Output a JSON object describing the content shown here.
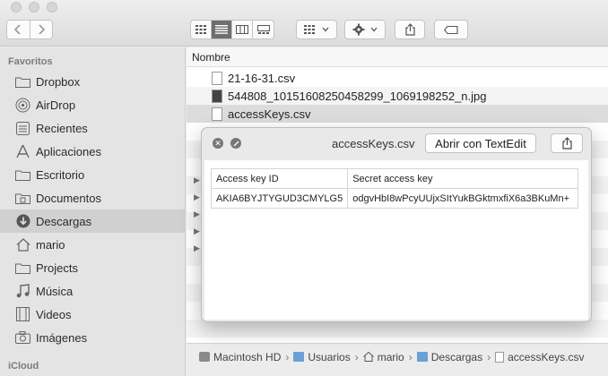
{
  "toolbar": {
    "icons": [
      "back-icon",
      "forward-icon",
      "icon-view-icon",
      "list-view-icon",
      "column-view-icon",
      "gallery-view-icon",
      "arrange-icon",
      "gear-icon",
      "share-icon",
      "tag-icon"
    ]
  },
  "sidebar": {
    "section_favorites": "Favoritos",
    "section_icloud": "iCloud",
    "items": [
      {
        "label": "Dropbox",
        "icon": "folder-icon"
      },
      {
        "label": "AirDrop",
        "icon": "airdrop-icon"
      },
      {
        "label": "Recientes",
        "icon": "recents-icon"
      },
      {
        "label": "Aplicaciones",
        "icon": "applications-icon"
      },
      {
        "label": "Escritorio",
        "icon": "desktop-icon"
      },
      {
        "label": "Documentos",
        "icon": "documents-icon"
      },
      {
        "label": "Descargas",
        "icon": "downloads-icon"
      },
      {
        "label": "mario",
        "icon": "home-icon"
      },
      {
        "label": "Projects",
        "icon": "folder-icon"
      },
      {
        "label": "Música",
        "icon": "music-icon"
      },
      {
        "label": "Videos",
        "icon": "videos-icon"
      },
      {
        "label": "Imágenes",
        "icon": "camera-icon"
      }
    ],
    "selected": "Descargas"
  },
  "filelist": {
    "column_name": "Nombre",
    "rows": [
      {
        "name": "21-16-31.csv",
        "icon": "document-icon"
      },
      {
        "name": "544808_10151608250458299_1069198252_n.jpg",
        "icon": "image-file-icon"
      },
      {
        "name": "accessKeys.csv",
        "icon": "document-icon"
      }
    ],
    "selected": "accessKeys.csv"
  },
  "quicklook": {
    "title": "accessKeys.csv",
    "open_button": "Abrir con TextEdit",
    "table": {
      "headers": [
        "Access key ID",
        "Secret access key"
      ],
      "rows": [
        [
          "AKIA6BYJTYGUD3CMYLG5",
          "odgvHbI8wPcyUUjxSItYukBGktmxfiX6a3BKuMn+"
        ]
      ]
    }
  },
  "pathbar": {
    "items": [
      {
        "label": "Macintosh HD",
        "icon": "hard-drive-icon"
      },
      {
        "label": "Usuarios",
        "icon": "folder-icon"
      },
      {
        "label": "mario",
        "icon": "home-icon"
      },
      {
        "label": "Descargas",
        "icon": "folder-icon"
      },
      {
        "label": "accessKeys.csv",
        "icon": "document-icon"
      }
    ],
    "separator": "›"
  }
}
